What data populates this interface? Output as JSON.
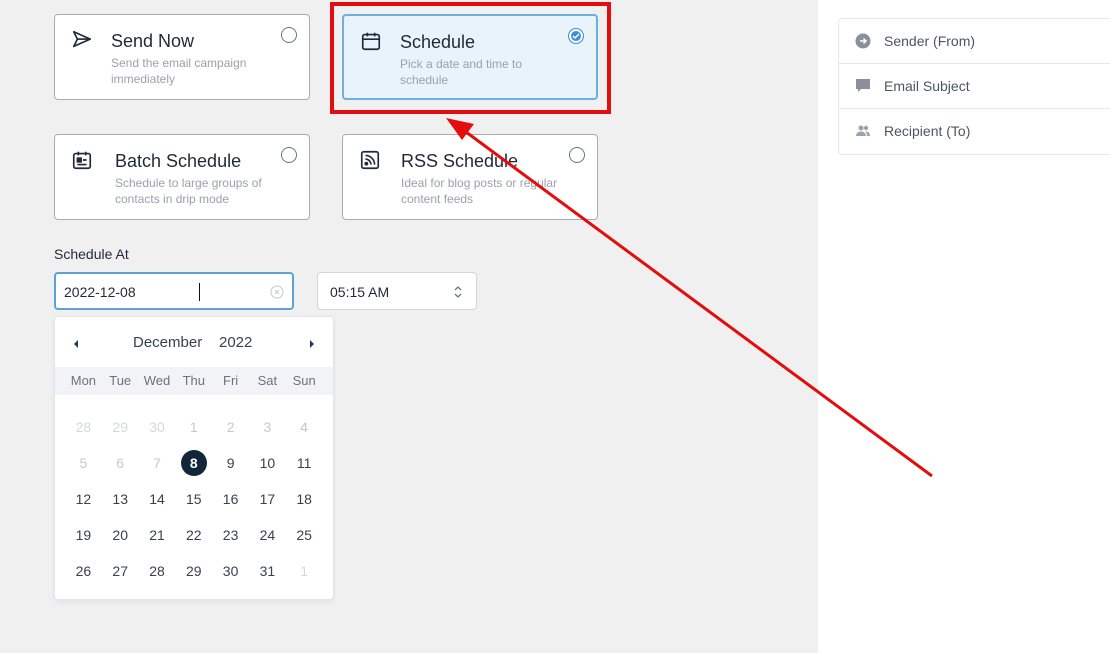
{
  "options": [
    {
      "title": "Send Now",
      "desc": "Send the email campaign immediately",
      "icon": "send-icon"
    },
    {
      "title": "Schedule",
      "desc": "Pick a date and time to schedule",
      "icon": "calendar-icon"
    },
    {
      "title": "Batch Schedule",
      "desc": "Schedule to large groups of contacts in drip mode",
      "icon": "batch-calendar-icon"
    },
    {
      "title": "RSS Schedule",
      "desc": "Ideal for blog posts or regular content feeds",
      "icon": "rss-icon"
    }
  ],
  "schedule": {
    "label": "Schedule At",
    "date_value": "2022-12-08",
    "time_value": "05:15 AM"
  },
  "calendar": {
    "month": "December",
    "year": "2022",
    "weekdays": [
      "Mon",
      "Tue",
      "Wed",
      "Thu",
      "Fri",
      "Sat",
      "Sun"
    ],
    "weeks": [
      [
        "28",
        "29",
        "30",
        "1",
        "2",
        "3",
        "4"
      ],
      [
        "5",
        "6",
        "7",
        "8",
        "9",
        "10",
        "11"
      ],
      [
        "12",
        "13",
        "14",
        "15",
        "16",
        "17",
        "18"
      ],
      [
        "19",
        "20",
        "21",
        "22",
        "23",
        "24",
        "25"
      ],
      [
        "26",
        "27",
        "28",
        "29",
        "30",
        "31",
        "1"
      ]
    ],
    "selected_day": "8"
  },
  "sidebar": {
    "items": [
      {
        "label": "Sender (From)",
        "icon": "arrow-circle-right-icon"
      },
      {
        "label": "Email Subject",
        "icon": "chat-bubble-icon"
      },
      {
        "label": "Recipient (To)",
        "icon": "users-icon"
      }
    ]
  },
  "colors": {
    "highlight": "#e30d0d",
    "accent": "#3b8fd6",
    "selected_day_bg": "#12263a"
  }
}
